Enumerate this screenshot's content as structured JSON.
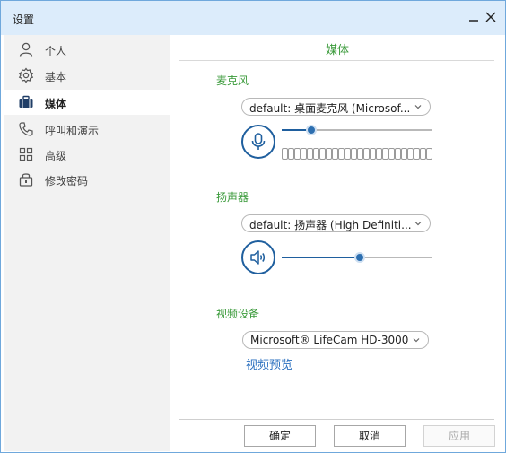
{
  "window": {
    "title": "设置",
    "minimize_icon": "minimize-icon",
    "close_icon": "close-icon"
  },
  "sidebar": {
    "items": [
      {
        "label": "个人",
        "icon": "person-icon",
        "active": false
      },
      {
        "label": "基本",
        "icon": "gear-icon",
        "active": false
      },
      {
        "label": "媒体",
        "icon": "briefcase-icon",
        "active": true
      },
      {
        "label": "呼叫和演示",
        "icon": "phone-icon",
        "active": false
      },
      {
        "label": "高级",
        "icon": "grid-icon",
        "active": false
      },
      {
        "label": "修改密码",
        "icon": "lock-icon",
        "active": false
      }
    ]
  },
  "main": {
    "section_title": "媒体",
    "microphone": {
      "label": "麦克风",
      "device": "default: 桌面麦克风 (Microsof...",
      "volume": 0.2
    },
    "speaker": {
      "label": "扬声器",
      "device": "default: 扬声器 (High Definiti...",
      "volume": 0.52
    },
    "video": {
      "label": "视频设备",
      "device": "Microsoft® LifeCam HD-3000",
      "preview_link": "视频预览"
    }
  },
  "buttons": {
    "ok": "确定",
    "cancel": "取消",
    "apply": "应用"
  },
  "colors": {
    "accent_green": "#3a9a3a",
    "accent_blue": "#1f5f9e",
    "titlebar": "#dcecfb"
  }
}
